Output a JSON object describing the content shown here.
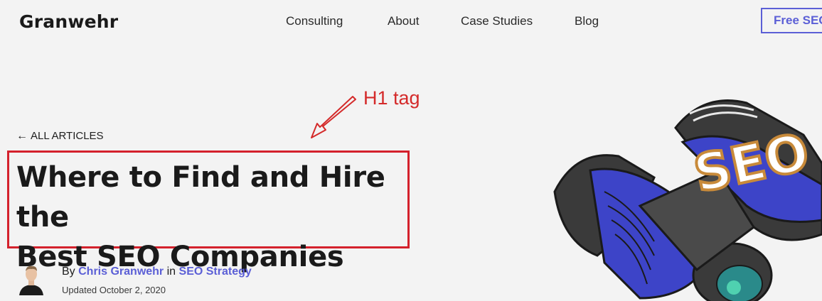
{
  "header": {
    "logo": "Granwehr",
    "nav": [
      "Consulting",
      "About",
      "Case Studies",
      "Blog"
    ],
    "cta": "Free SEO"
  },
  "annotation": {
    "label": "H1 tag",
    "color": "#d42a2a"
  },
  "article": {
    "back_label": "ALL ARTICLES",
    "title_line1": "Where to Find and Hire the",
    "title_line2": "Best SEO Companies",
    "by": "By",
    "author": "Chris Granwehr",
    "in": "in",
    "category": "SEO Strategy",
    "updated": "Updated October 2, 2020"
  },
  "hero": {
    "text": "SEO",
    "icon": "binoculars-illustration"
  },
  "colors": {
    "accent": "#5b5fd6",
    "background": "#f3f3f3",
    "highlight": "#d4212c"
  }
}
